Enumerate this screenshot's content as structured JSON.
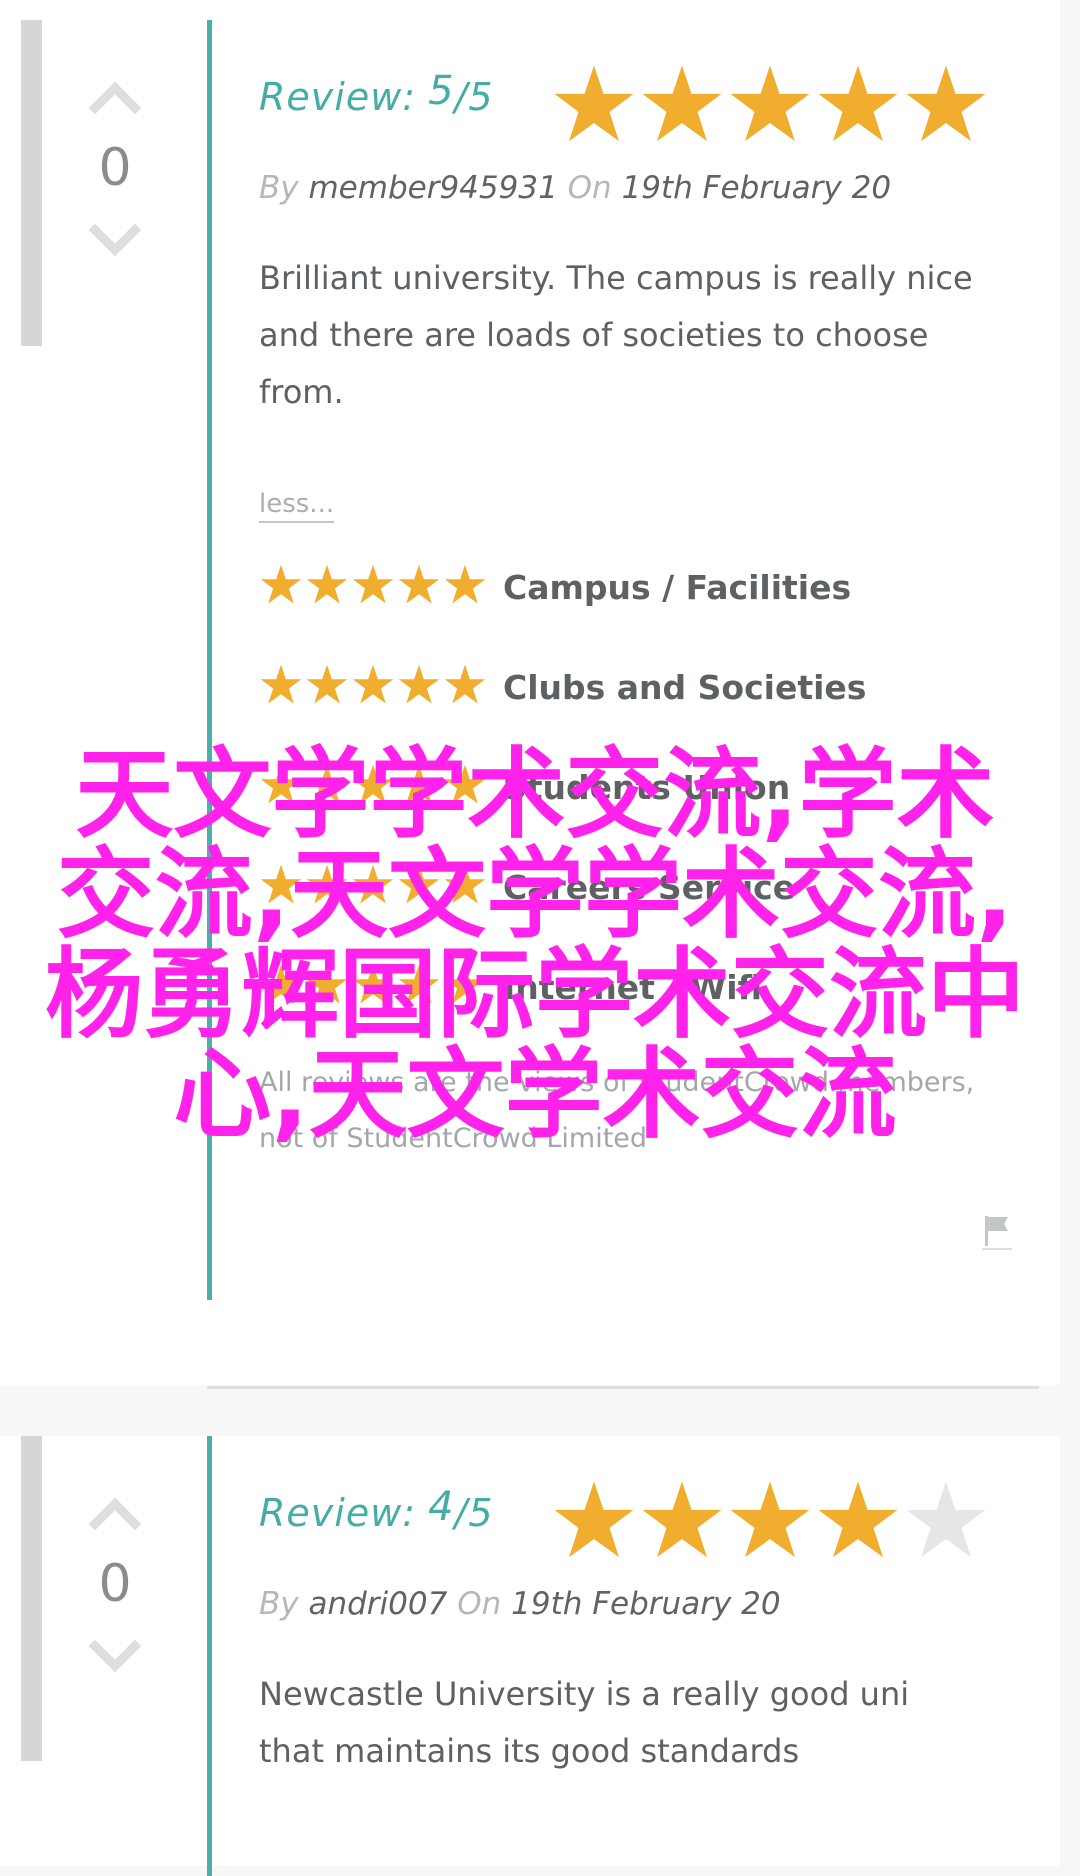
{
  "reviews": [
    {
      "votes": "0",
      "review_label": "Review:",
      "score": "5",
      "max": "/5",
      "rating_stars": 5,
      "by_label": "By",
      "author": "member945931",
      "on_label": "On",
      "date": "19th February 20",
      "text": "Brilliant university. The campus is really nice and there are loads of societies to choose from.",
      "less_label": "less...",
      "categories": [
        {
          "label": "Campus / Facilities",
          "stars": 5
        },
        {
          "label": "Clubs and Societies",
          "stars": 5
        },
        {
          "label": "Students Union",
          "stars": 5
        },
        {
          "label": "Careers Service",
          "stars": 5
        },
        {
          "label": "Internet / Wifi",
          "stars": 5
        }
      ],
      "disclaimer": "All reviews are the views of StudentCrowd members, not of StudentCrowd Limited"
    },
    {
      "votes": "0",
      "review_label": "Review:",
      "score": "4",
      "max": "/5",
      "rating_stars": 4,
      "by_label": "By",
      "author": "andri007",
      "on_label": "On",
      "date": "19th February 20",
      "text": "Newcastle University is a really good uni that maintains its good standards"
    }
  ],
  "overlay_text": "天文学学术交流,学术交流,天文学学术交流,杨勇辉国际学术交流中心,天文学术交流",
  "colors": {
    "teal": "#45ada5",
    "star_filled": "#f0ad2e",
    "star_empty": "#e6e6e6",
    "overlay": "#ff22ea"
  }
}
